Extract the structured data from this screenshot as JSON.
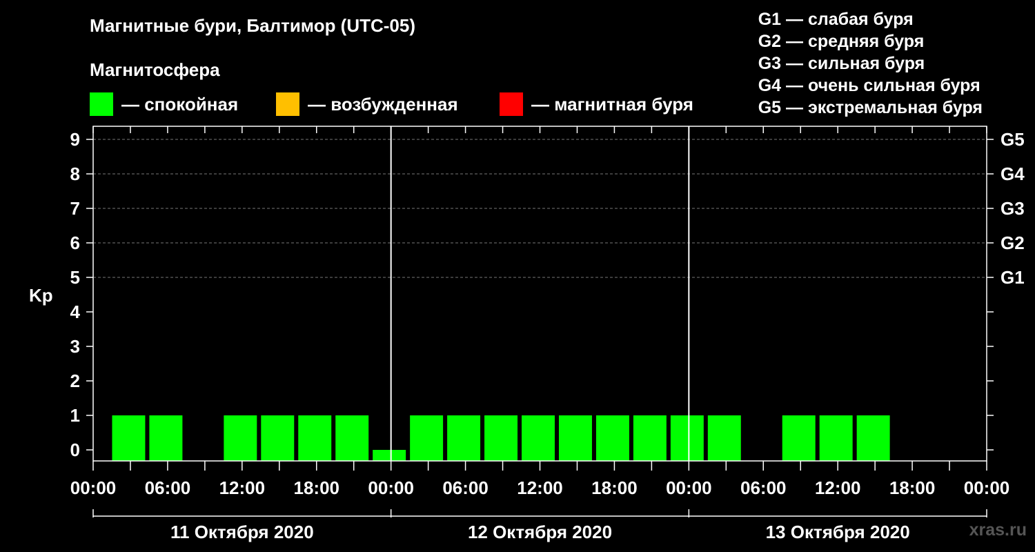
{
  "title": "Магнитные бури, Балтимор (UTC-05)",
  "legend": {
    "heading": "Магнитосфера",
    "items": [
      {
        "color": "#00ff00",
        "label": "— спокойная"
      },
      {
        "color": "#ffbf00",
        "label": "— возбужденная"
      },
      {
        "color": "#ff0000",
        "label": "— магнитная буря"
      }
    ]
  },
  "storm_scale": [
    "G1 — слабая буря",
    "G2 — средняя буря",
    "G3 — сильная буря",
    "G4 — очень сильная буря",
    "G5 — экстремальная буря"
  ],
  "watermark": "xras.ru",
  "chart_data": {
    "type": "bar",
    "ylabel": "Kp",
    "ylim": [
      0,
      9
    ],
    "y_ticks": [
      "0",
      "1",
      "2",
      "3",
      "4",
      "5",
      "6",
      "7",
      "8",
      "9"
    ],
    "right_axis": [
      {
        "kp": 5,
        "label": "G1"
      },
      {
        "kp": 6,
        "label": "G2"
      },
      {
        "kp": 7,
        "label": "G3"
      },
      {
        "kp": 8,
        "label": "G4"
      },
      {
        "kp": 9,
        "label": "G5"
      }
    ],
    "grid": "dashed horizontal at Kp 5–9",
    "x_range_hours": [
      0,
      72
    ],
    "x_ticks": [
      "00:00",
      "06:00",
      "12:00",
      "18:00",
      "00:00",
      "06:00",
      "12:00",
      "18:00",
      "00:00",
      "06:00",
      "12:00",
      "18:00",
      "00:00"
    ],
    "days": [
      "11 Октября 2020",
      "12 Октября 2020",
      "13 Октября 2020"
    ],
    "bar_color": "#00ff00",
    "bars": [
      {
        "start_hour": 1.5,
        "value": 1
      },
      {
        "start_hour": 4.5,
        "value": 1
      },
      {
        "start_hour": 10.5,
        "value": 1
      },
      {
        "start_hour": 13.5,
        "value": 1
      },
      {
        "start_hour": 16.5,
        "value": 1
      },
      {
        "start_hour": 19.5,
        "value": 1
      },
      {
        "start_hour": 22.5,
        "value": 0
      },
      {
        "start_hour": 25.5,
        "value": 1
      },
      {
        "start_hour": 28.5,
        "value": 1
      },
      {
        "start_hour": 31.5,
        "value": 1
      },
      {
        "start_hour": 34.5,
        "value": 1
      },
      {
        "start_hour": 37.5,
        "value": 1
      },
      {
        "start_hour": 40.5,
        "value": 1
      },
      {
        "start_hour": 43.5,
        "value": 1
      },
      {
        "start_hour": 46.5,
        "value": 1
      },
      {
        "start_hour": 49.5,
        "value": 1
      },
      {
        "start_hour": 55.5,
        "value": 1
      },
      {
        "start_hour": 58.5,
        "value": 1
      },
      {
        "start_hour": 61.5,
        "value": 1
      }
    ]
  }
}
